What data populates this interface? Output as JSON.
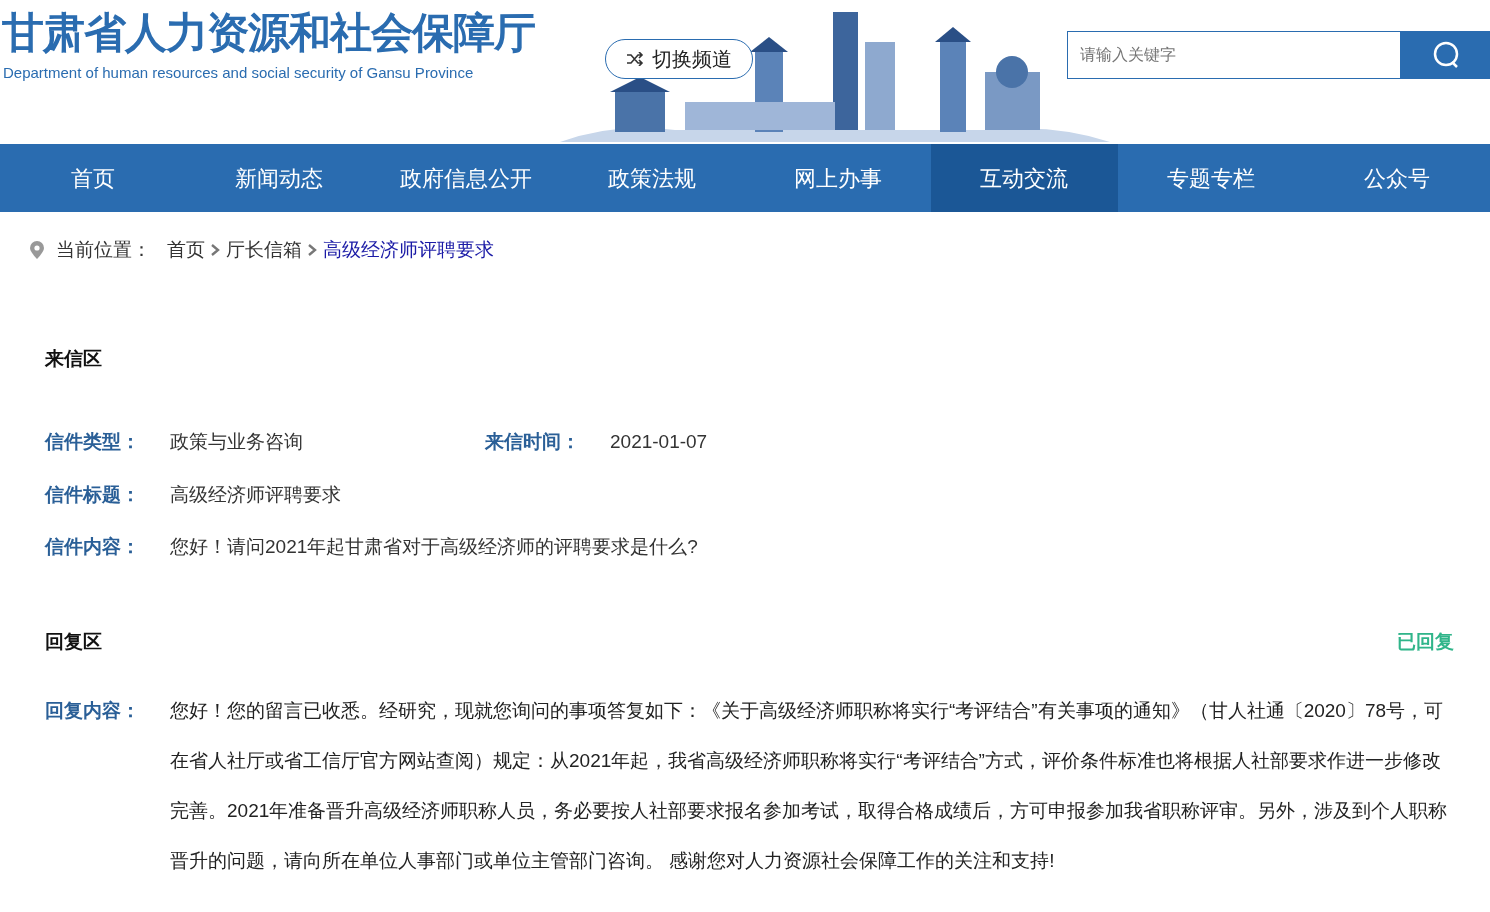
{
  "header": {
    "title": "甘肃省人力资源和社会保障厅",
    "subtitle": "Department of human resources and social security of Gansu Province",
    "channel_button": "切换频道",
    "search": {
      "placeholder": "请输入关键字"
    }
  },
  "nav": [
    {
      "label": "首页",
      "selected": false
    },
    {
      "label": "新闻动态",
      "selected": false
    },
    {
      "label": "政府信息公开",
      "selected": false
    },
    {
      "label": "政策法规",
      "selected": false
    },
    {
      "label": "网上办事",
      "selected": false
    },
    {
      "label": "互动交流",
      "selected": true
    },
    {
      "label": "专题专栏",
      "selected": false
    },
    {
      "label": "公众号",
      "selected": false
    }
  ],
  "breadcrumb": {
    "label": "当前位置：",
    "items": [
      {
        "text": "首页",
        "current": false
      },
      {
        "text": "厅长信箱",
        "current": false
      },
      {
        "text": "高级经济师评聘要求",
        "current": true
      }
    ]
  },
  "letter": {
    "heading": "来信区",
    "type_label": "信件类型：",
    "type_value": "政策与业务咨询",
    "time_label": "来信时间：",
    "time_value": "2021-01-07",
    "title_label": "信件标题：",
    "title_value": "高级经济师评聘要求",
    "content_label": "信件内容：",
    "content_value": "您好！请问2021年起甘肃省对于高级经济师的评聘要求是什么?"
  },
  "reply": {
    "heading": "回复区",
    "status": "已回复",
    "content_label": "回复内容：",
    "content_value": "您好！您的留言已收悉。经研究，现就您询问的事项答复如下：《关于高级经济师职称将实行“考评结合”有关事项的通知》（甘人社通〔2020〕78号，可在省人社厅或省工信厅官方网站查阅）规定：从2021年起，我省高级经济师职称将实行“考评结合”方式，评价条件标准也将根据人社部要求作进一步修改完善。2021年准备晋升高级经济师职称人员，务必要按人社部要求报名参加考试，取得合格成绩后，方可申报参加我省职称评审。另外，涉及到个人职称晋升的问题，请向所在单位人事部门或单位主管部门咨询。 感谢您对人力资源社会保障工作的关注和支持!"
  }
}
